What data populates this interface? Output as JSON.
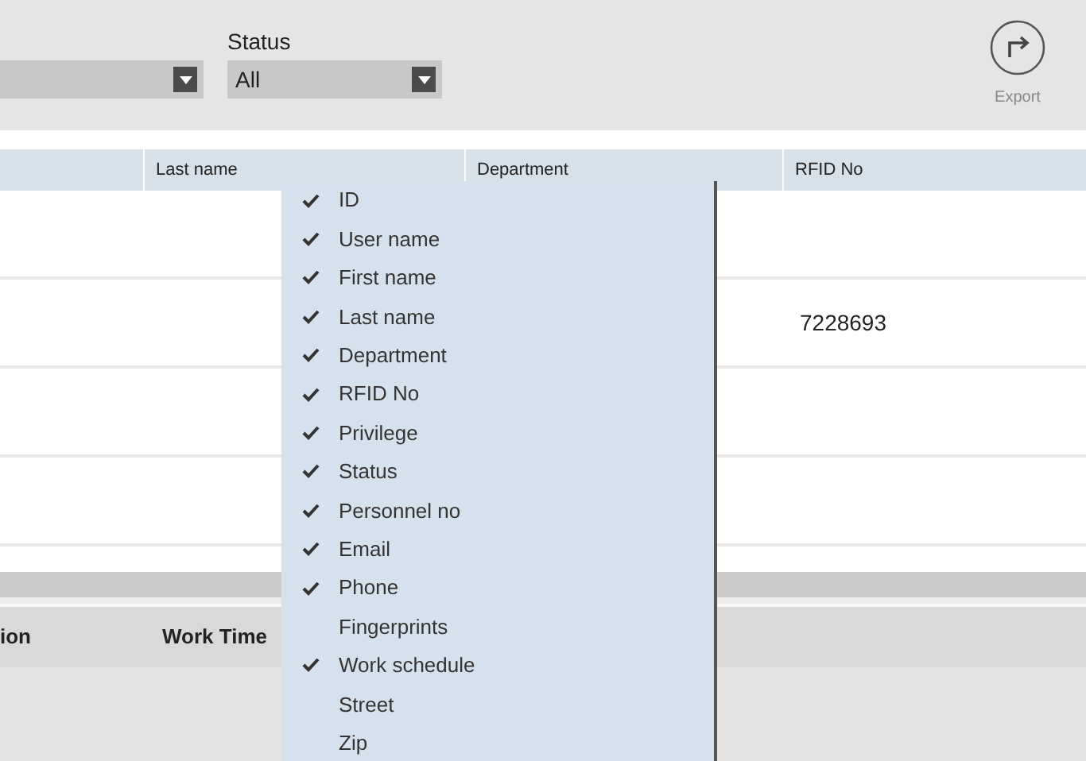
{
  "toolbar": {
    "status_filter": {
      "label": "Status",
      "value": "All"
    },
    "export": {
      "label": "Export"
    }
  },
  "table": {
    "columns": [
      null,
      "Last name",
      "Department",
      "RFID No"
    ],
    "rows": [
      [
        null,
        null,
        null,
        null
      ],
      [
        null,
        null,
        null,
        "7228693"
      ],
      [
        null,
        null,
        null,
        null
      ],
      [
        null,
        null,
        null,
        null
      ]
    ]
  },
  "lower_table": {
    "columns": [
      "ion",
      "Work Time"
    ]
  },
  "column_menu": [
    {
      "label": "ID",
      "checked": true
    },
    {
      "label": "User name",
      "checked": true
    },
    {
      "label": "First name",
      "checked": true
    },
    {
      "label": "Last name",
      "checked": true
    },
    {
      "label": "Department",
      "checked": true
    },
    {
      "label": "RFID No",
      "checked": true
    },
    {
      "label": "Privilege",
      "checked": true
    },
    {
      "label": "Status",
      "checked": true
    },
    {
      "label": "Personnel no",
      "checked": true
    },
    {
      "label": "Email",
      "checked": true
    },
    {
      "label": "Phone",
      "checked": true
    },
    {
      "label": "Fingerprints",
      "checked": false
    },
    {
      "label": "Work schedule",
      "checked": true
    },
    {
      "label": "Street",
      "checked": false
    },
    {
      "label": "Zip",
      "checked": false
    }
  ]
}
